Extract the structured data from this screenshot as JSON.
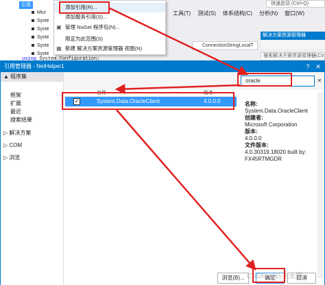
{
  "background": {
    "menubar": [
      "工具(T)",
      "测试(S)",
      "体系结构(C)",
      "分析(N)",
      "窗口(W)"
    ],
    "quick_launch": "快速启动 (Ctrl+Q)",
    "combo_connection": "ConnectionStringLocalT",
    "solution_explorer_title": "解决方案资源管理器",
    "solution_explorer_search": "搜索解决方案资源管理器(Ctrl+;)",
    "tree_references": "引用",
    "tree_items": [
      "Micr",
      "Syste",
      "Syste",
      "Syste",
      "Syste",
      "Syste"
    ],
    "code_keyword": "using",
    "code_text": " System.Configuration;"
  },
  "context_menu": {
    "items": [
      {
        "label": "添加引用(R)...",
        "icon": "none"
      },
      {
        "label": "添加服务引用(S)...",
        "icon": "none"
      },
      {
        "label": "管理 NuGet 程序包(N)...",
        "icon": "nuget-icon"
      },
      {
        "label": "限定为此范围(S)",
        "icon": "none"
      },
      {
        "label": "新建 解决方案资源管理器 视图(N)",
        "icon": "new-view-icon"
      }
    ]
  },
  "dialog": {
    "title": "引用管理器 - NetHelper1",
    "help": "?",
    "close": "✕",
    "nav": {
      "header": "▲ 程序集",
      "sub_items": [
        "框架",
        "扩展",
        "最近",
        "搜索结果"
      ],
      "groups": [
        "▷ 解决方案",
        "▷ COM",
        "▷ 浏览"
      ]
    },
    "list": {
      "col_name": "名称",
      "col_version": "版本",
      "rows": [
        {
          "checked": true,
          "name": "System.Data.OracleClient",
          "version": "4.0.0.0"
        }
      ]
    },
    "search": {
      "value": "oracle",
      "clear": "✕"
    },
    "details": {
      "name_label": "名称:",
      "name_value": "System.Data.OracleClient",
      "creator_label": "创建者:",
      "creator_value": "Microsoft Corporation",
      "version_label": "版本:",
      "version_value": "4.0.0.0",
      "file_version_label": "文件版本:",
      "file_version_value": "4.0.30319.18020 built by:",
      "file_version_value2": "FX45RTMGDR"
    },
    "buttons": {
      "browse": "浏览(B)...",
      "ok": "确定",
      "cancel": "取消"
    }
  },
  "watermark": "CSDN @匹夫无罪",
  "colors": {
    "accent": "#007acc",
    "selection": "#3399ff",
    "annotation_red": "#e02020"
  }
}
